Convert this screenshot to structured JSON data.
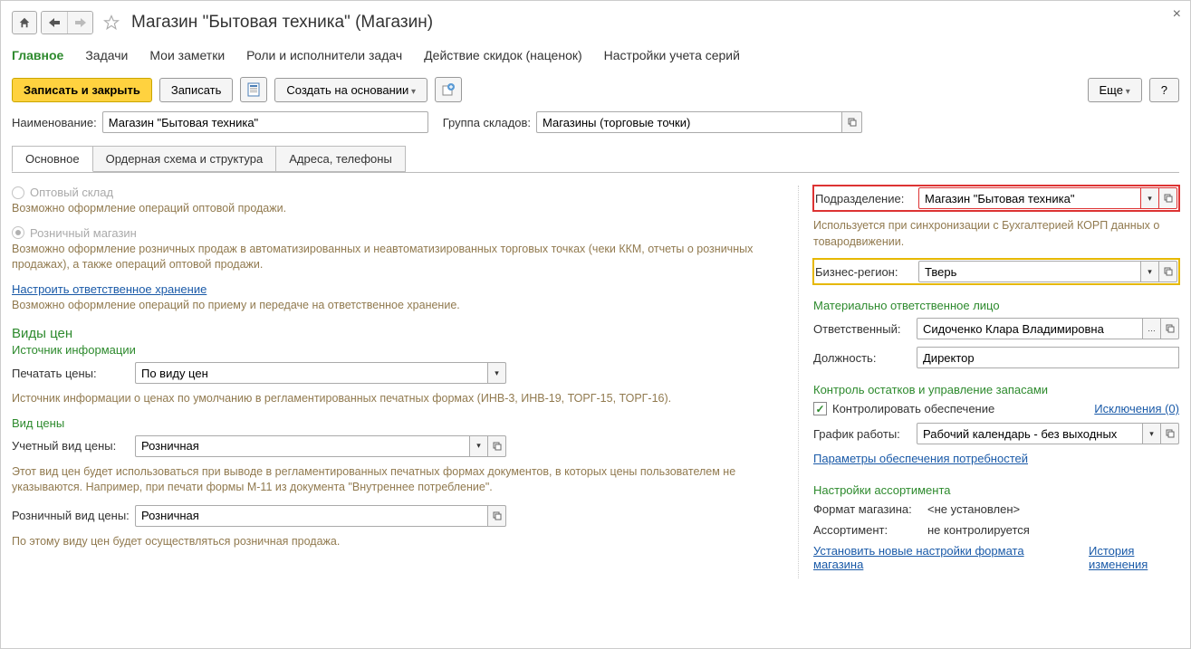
{
  "header": {
    "title": "Магазин \"Бытовая техника\"  (Магазин)"
  },
  "main_tabs": {
    "t0": "Главное",
    "t1": "Задачи",
    "t2": "Мои заметки",
    "t3": "Роли и исполнители задач",
    "t4": "Действие скидок (наценок)",
    "t5": "Настройки учета серий"
  },
  "toolbar": {
    "save_close": "Записать и закрыть",
    "save": "Записать",
    "create_based": "Создать на основании",
    "more": "Еще",
    "help": "?"
  },
  "top_fields": {
    "name_label": "Наименование:",
    "name_value": "Магазин \"Бытовая техника\"",
    "group_label": "Группа складов:",
    "group_value": "Магазины (торговые точки)"
  },
  "subtabs": {
    "s0": "Основное",
    "s1": "Ордерная схема и структура",
    "s2": "Адреса, телефоны"
  },
  "left": {
    "radio_wholesale": "Оптовый склад",
    "hint_wholesale": "Возможно оформление операций оптовой продажи.",
    "radio_retail": "Розничный магазин",
    "hint_retail": "Возможно оформление розничных продаж в автоматизированных и неавтоматизированных торговых точках (чеки ККМ, отчеты о розничных продажах), а также операций оптовой продажи.",
    "link_storage": "Настроить ответственное хранение",
    "hint_storage": "Возможно оформление операций по приему и передаче на ответственное хранение.",
    "section_prices": "Виды цен",
    "sub_source": "Источник информации",
    "print_prices_label": "Печатать цены:",
    "print_prices_value": "По виду цен",
    "hint_source": "Источник информации о ценах по умолчанию в регламентированных печатных формах (ИНВ-3, ИНВ-19, ТОРГ-15, ТОРГ-16).",
    "sub_pricetype": "Вид цены",
    "account_label": "Учетный вид цены:",
    "account_value": "Розничная",
    "hint_account": "Этот вид цен будет использоваться при выводе в регламентированных печатных формах документов, в которых цены пользователем не указываются. Например, при печати формы М-11 из документа \"Внутреннее потребление\".",
    "retail_label": "Розничный вид цены:",
    "retail_value": "Розничная",
    "hint_retail_price": "По этому виду цен будет осуществляться розничная продажа."
  },
  "right": {
    "dept_label": "Подразделение:",
    "dept_value": "Магазин \"Бытовая техника\"",
    "dept_hint": "Используется при синхронизации с Бухгалтерией КОРП данных о товародвижении.",
    "region_label": "Бизнес-регион:",
    "region_value": "Тверь",
    "section_mol": "Материально ответственное лицо",
    "resp_label": "Ответственный:",
    "resp_value": "Сидоченко Клара Владимировна",
    "position_label": "Должность:",
    "position_value": "Директор",
    "section_stock": "Контроль остатков и управление запасами",
    "check_control": "Контролировать обеспечение",
    "link_exceptions": "Исключения (0)",
    "schedule_label": "График работы:",
    "schedule_value": "Рабочий календарь - без выходных",
    "link_params": "Параметры обеспечения потребностей",
    "section_assort": "Настройки ассортимента",
    "format_label": "Формат магазина:",
    "format_value": "<не установлен>",
    "assort_label": "Ассортимент:",
    "assort_value": "не контролируется",
    "link_new_settings": "Установить новые настройки формата магазина",
    "link_history": "История изменения"
  }
}
